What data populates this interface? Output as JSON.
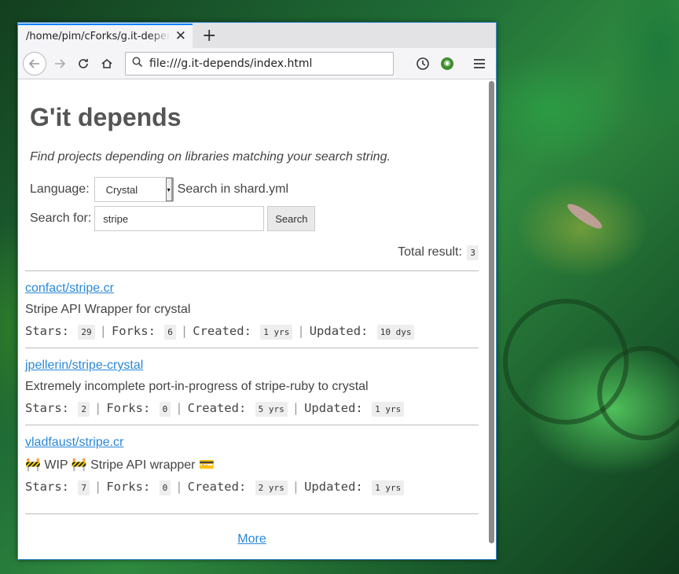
{
  "browser": {
    "tab_title": "/home/pim/cForks/g.it-depends/index.html",
    "tab_close": "✕",
    "new_tab": "+",
    "url": "file:///g.it-depends/index.html"
  },
  "page": {
    "title": "G'it depends",
    "subtitle": "Find projects depending on libraries matching your search string.",
    "language_label": "Language:",
    "language_value": "Crystal",
    "search_in": "Search in shard.yml",
    "search_label": "Search for:",
    "search_value": "stripe",
    "search_button": "Search",
    "total_label": "Total result:",
    "total_value": "3",
    "stars_label": "Stars:",
    "forks_label": "Forks:",
    "created_label": "Created:",
    "updated_label": "Updated:",
    "more": "More"
  },
  "results": [
    {
      "repo": "confact/stripe.cr",
      "desc": "Stripe API Wrapper for crystal",
      "stars": "29",
      "forks": "6",
      "created": "1 yrs",
      "updated": "10 dys"
    },
    {
      "repo": "jpellerin/stripe-crystal",
      "desc": "Extremely incomplete port-in-progress of stripe-ruby to crystal",
      "stars": "2",
      "forks": "0",
      "created": "5 yrs",
      "updated": "1 yrs"
    },
    {
      "repo": "vladfaust/stripe.cr",
      "desc": "🚧 WIP 🚧 Stripe API wrapper 💳",
      "stars": "7",
      "forks": "0",
      "created": "2 yrs",
      "updated": "1 yrs"
    }
  ]
}
